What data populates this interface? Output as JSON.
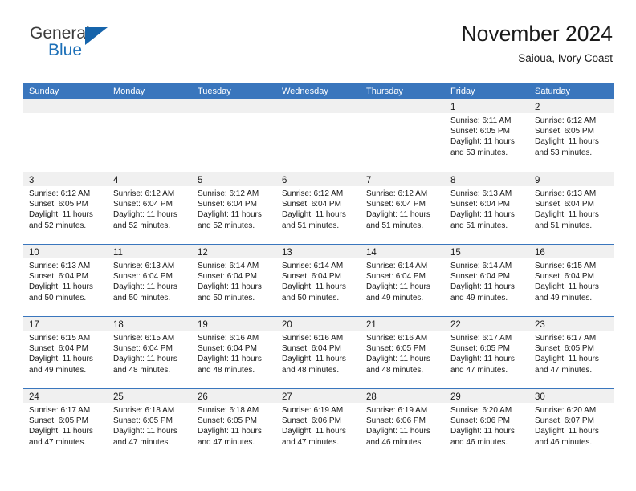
{
  "brand": {
    "name_top": "General",
    "name_bottom": "Blue",
    "triangle_color": "#1664ab",
    "blue_color": "#1d70b8"
  },
  "header": {
    "title": "November 2024",
    "subtitle": "Saioua, Ivory Coast"
  },
  "theme": {
    "header_blue": "#3a76bd",
    "daynum_band": "#f0f0f0",
    "text": "#1a1a1a"
  },
  "weekdays": [
    "Sunday",
    "Monday",
    "Tuesday",
    "Wednesday",
    "Thursday",
    "Friday",
    "Saturday"
  ],
  "weeks": [
    [
      {
        "day": "",
        "empty": true
      },
      {
        "day": "",
        "empty": true
      },
      {
        "day": "",
        "empty": true
      },
      {
        "day": "",
        "empty": true
      },
      {
        "day": "",
        "empty": true
      },
      {
        "day": "1",
        "sunrise": "Sunrise: 6:11 AM",
        "sunset": "Sunset: 6:05 PM",
        "daylight1": "Daylight: 11 hours",
        "daylight2": "and 53 minutes."
      },
      {
        "day": "2",
        "sunrise": "Sunrise: 6:12 AM",
        "sunset": "Sunset: 6:05 PM",
        "daylight1": "Daylight: 11 hours",
        "daylight2": "and 53 minutes."
      }
    ],
    [
      {
        "day": "3",
        "sunrise": "Sunrise: 6:12 AM",
        "sunset": "Sunset: 6:05 PM",
        "daylight1": "Daylight: 11 hours",
        "daylight2": "and 52 minutes."
      },
      {
        "day": "4",
        "sunrise": "Sunrise: 6:12 AM",
        "sunset": "Sunset: 6:04 PM",
        "daylight1": "Daylight: 11 hours",
        "daylight2": "and 52 minutes."
      },
      {
        "day": "5",
        "sunrise": "Sunrise: 6:12 AM",
        "sunset": "Sunset: 6:04 PM",
        "daylight1": "Daylight: 11 hours",
        "daylight2": "and 52 minutes."
      },
      {
        "day": "6",
        "sunrise": "Sunrise: 6:12 AM",
        "sunset": "Sunset: 6:04 PM",
        "daylight1": "Daylight: 11 hours",
        "daylight2": "and 51 minutes."
      },
      {
        "day": "7",
        "sunrise": "Sunrise: 6:12 AM",
        "sunset": "Sunset: 6:04 PM",
        "daylight1": "Daylight: 11 hours",
        "daylight2": "and 51 minutes."
      },
      {
        "day": "8",
        "sunrise": "Sunrise: 6:13 AM",
        "sunset": "Sunset: 6:04 PM",
        "daylight1": "Daylight: 11 hours",
        "daylight2": "and 51 minutes."
      },
      {
        "day": "9",
        "sunrise": "Sunrise: 6:13 AM",
        "sunset": "Sunset: 6:04 PM",
        "daylight1": "Daylight: 11 hours",
        "daylight2": "and 51 minutes."
      }
    ],
    [
      {
        "day": "10",
        "sunrise": "Sunrise: 6:13 AM",
        "sunset": "Sunset: 6:04 PM",
        "daylight1": "Daylight: 11 hours",
        "daylight2": "and 50 minutes."
      },
      {
        "day": "11",
        "sunrise": "Sunrise: 6:13 AM",
        "sunset": "Sunset: 6:04 PM",
        "daylight1": "Daylight: 11 hours",
        "daylight2": "and 50 minutes."
      },
      {
        "day": "12",
        "sunrise": "Sunrise: 6:14 AM",
        "sunset": "Sunset: 6:04 PM",
        "daylight1": "Daylight: 11 hours",
        "daylight2": "and 50 minutes."
      },
      {
        "day": "13",
        "sunrise": "Sunrise: 6:14 AM",
        "sunset": "Sunset: 6:04 PM",
        "daylight1": "Daylight: 11 hours",
        "daylight2": "and 50 minutes."
      },
      {
        "day": "14",
        "sunrise": "Sunrise: 6:14 AM",
        "sunset": "Sunset: 6:04 PM",
        "daylight1": "Daylight: 11 hours",
        "daylight2": "and 49 minutes."
      },
      {
        "day": "15",
        "sunrise": "Sunrise: 6:14 AM",
        "sunset": "Sunset: 6:04 PM",
        "daylight1": "Daylight: 11 hours",
        "daylight2": "and 49 minutes."
      },
      {
        "day": "16",
        "sunrise": "Sunrise: 6:15 AM",
        "sunset": "Sunset: 6:04 PM",
        "daylight1": "Daylight: 11 hours",
        "daylight2": "and 49 minutes."
      }
    ],
    [
      {
        "day": "17",
        "sunrise": "Sunrise: 6:15 AM",
        "sunset": "Sunset: 6:04 PM",
        "daylight1": "Daylight: 11 hours",
        "daylight2": "and 49 minutes."
      },
      {
        "day": "18",
        "sunrise": "Sunrise: 6:15 AM",
        "sunset": "Sunset: 6:04 PM",
        "daylight1": "Daylight: 11 hours",
        "daylight2": "and 48 minutes."
      },
      {
        "day": "19",
        "sunrise": "Sunrise: 6:16 AM",
        "sunset": "Sunset: 6:04 PM",
        "daylight1": "Daylight: 11 hours",
        "daylight2": "and 48 minutes."
      },
      {
        "day": "20",
        "sunrise": "Sunrise: 6:16 AM",
        "sunset": "Sunset: 6:04 PM",
        "daylight1": "Daylight: 11 hours",
        "daylight2": "and 48 minutes."
      },
      {
        "day": "21",
        "sunrise": "Sunrise: 6:16 AM",
        "sunset": "Sunset: 6:05 PM",
        "daylight1": "Daylight: 11 hours",
        "daylight2": "and 48 minutes."
      },
      {
        "day": "22",
        "sunrise": "Sunrise: 6:17 AM",
        "sunset": "Sunset: 6:05 PM",
        "daylight1": "Daylight: 11 hours",
        "daylight2": "and 47 minutes."
      },
      {
        "day": "23",
        "sunrise": "Sunrise: 6:17 AM",
        "sunset": "Sunset: 6:05 PM",
        "daylight1": "Daylight: 11 hours",
        "daylight2": "and 47 minutes."
      }
    ],
    [
      {
        "day": "24",
        "sunrise": "Sunrise: 6:17 AM",
        "sunset": "Sunset: 6:05 PM",
        "daylight1": "Daylight: 11 hours",
        "daylight2": "and 47 minutes."
      },
      {
        "day": "25",
        "sunrise": "Sunrise: 6:18 AM",
        "sunset": "Sunset: 6:05 PM",
        "daylight1": "Daylight: 11 hours",
        "daylight2": "and 47 minutes."
      },
      {
        "day": "26",
        "sunrise": "Sunrise: 6:18 AM",
        "sunset": "Sunset: 6:05 PM",
        "daylight1": "Daylight: 11 hours",
        "daylight2": "and 47 minutes."
      },
      {
        "day": "27",
        "sunrise": "Sunrise: 6:19 AM",
        "sunset": "Sunset: 6:06 PM",
        "daylight1": "Daylight: 11 hours",
        "daylight2": "and 47 minutes."
      },
      {
        "day": "28",
        "sunrise": "Sunrise: 6:19 AM",
        "sunset": "Sunset: 6:06 PM",
        "daylight1": "Daylight: 11 hours",
        "daylight2": "and 46 minutes."
      },
      {
        "day": "29",
        "sunrise": "Sunrise: 6:20 AM",
        "sunset": "Sunset: 6:06 PM",
        "daylight1": "Daylight: 11 hours",
        "daylight2": "and 46 minutes."
      },
      {
        "day": "30",
        "sunrise": "Sunrise: 6:20 AM",
        "sunset": "Sunset: 6:07 PM",
        "daylight1": "Daylight: 11 hours",
        "daylight2": "and 46 minutes."
      }
    ]
  ]
}
